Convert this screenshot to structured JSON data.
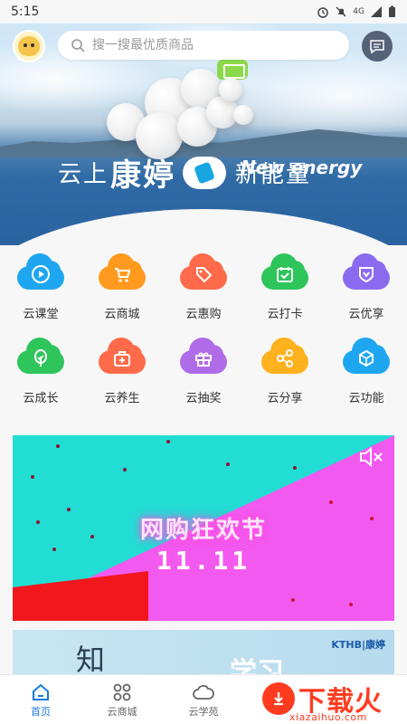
{
  "status_bar": {
    "time": "5:15",
    "network": "4G"
  },
  "header": {
    "search_placeholder": "搜一搜最优质商品"
  },
  "hero": {
    "title_small": "云上",
    "title_large": "康婷",
    "title_en": "New energy",
    "title_tail": "新能量"
  },
  "grid": {
    "items": [
      {
        "label": "云课堂",
        "icon": "play-icon",
        "color": "#1ea7f0"
      },
      {
        "label": "云商城",
        "icon": "cart-icon",
        "color": "#ff9a1e"
      },
      {
        "label": "云惠购",
        "icon": "tag-icon",
        "color": "#ff6b4a"
      },
      {
        "label": "云打卡",
        "icon": "calendar-icon",
        "color": "#2ec55a"
      },
      {
        "label": "云优享",
        "icon": "shield-icon",
        "color": "#8a6bf0"
      },
      {
        "label": "云成长",
        "icon": "tree-icon",
        "color": "#2ec55a"
      },
      {
        "label": "云养生",
        "icon": "medkit-icon",
        "color": "#ff6b4a"
      },
      {
        "label": "云抽奖",
        "icon": "gift-icon",
        "color": "#b06be8"
      },
      {
        "label": "云分享",
        "icon": "share-icon",
        "color": "#ffb11e"
      },
      {
        "label": "云功能",
        "icon": "cube-icon",
        "color": "#1ea7f0"
      }
    ]
  },
  "banner": {
    "title": "网购狂欢节",
    "subtitle": "11.11"
  },
  "banner2": {
    "char": "知",
    "brand": "KTHB|康婷",
    "big_text": "学习"
  },
  "bottom_nav": {
    "items": [
      {
        "label": "首页",
        "icon": "home-icon",
        "active": true
      },
      {
        "label": "云商城",
        "icon": "grid-icon",
        "active": false
      },
      {
        "label": "云学苑",
        "icon": "cloud-icon",
        "active": false
      }
    ]
  },
  "watermark": {
    "text": "下载火",
    "url": "xiazaihuo.com"
  },
  "colors": {
    "accent": "#1a7be0",
    "watermark": "#ff3b1f"
  }
}
